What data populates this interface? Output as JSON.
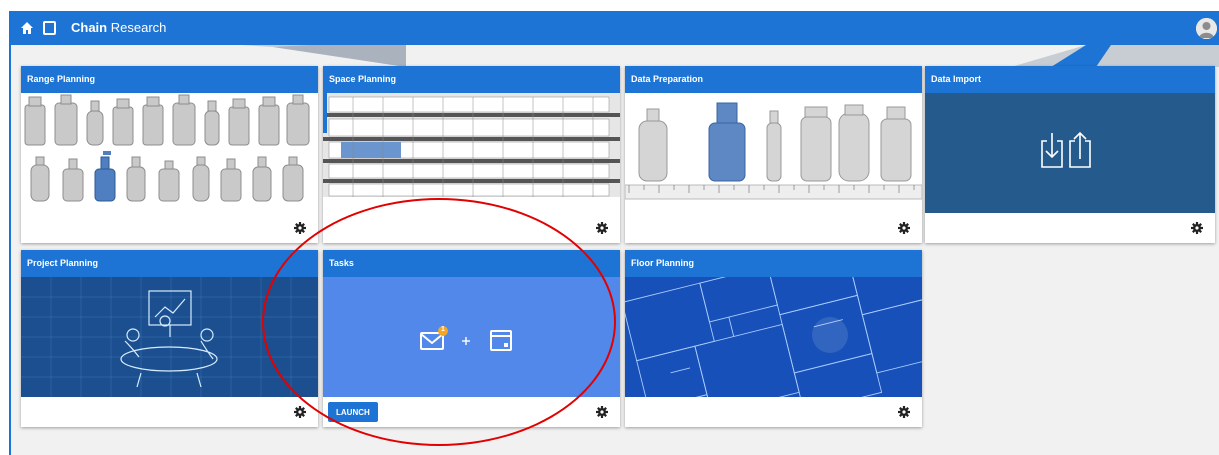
{
  "header": {
    "brand_bold": "Chain",
    "brand_light": "Research",
    "icons": [
      "home-icon",
      "tablet-icon",
      "user-avatar-icon"
    ]
  },
  "tiles": [
    {
      "id": "range-planning",
      "title": "Range Planning",
      "icon": "gear-icon"
    },
    {
      "id": "space-planning",
      "title": "Space Planning",
      "icon": "gear-icon"
    },
    {
      "id": "data-preparation",
      "title": "Data Preparation",
      "icon": "gear-icon"
    },
    {
      "id": "data-import",
      "title": "Data Import",
      "icon": "gear-icon"
    },
    {
      "id": "project-planning",
      "title": "Project Planning",
      "icon": "gear-icon"
    },
    {
      "id": "tasks",
      "title": "Tasks",
      "icon": "gear-icon",
      "button": "LAUNCH",
      "badge": "1"
    },
    {
      "id": "floor-planning",
      "title": "Floor Planning",
      "icon": "gear-icon"
    }
  ],
  "colors": {
    "primary": "#1e74d4",
    "data_import_bg": "#245a8c",
    "tasks_bg": "#5288ea",
    "badge": "#f5a623",
    "annotation": "#e20000"
  }
}
